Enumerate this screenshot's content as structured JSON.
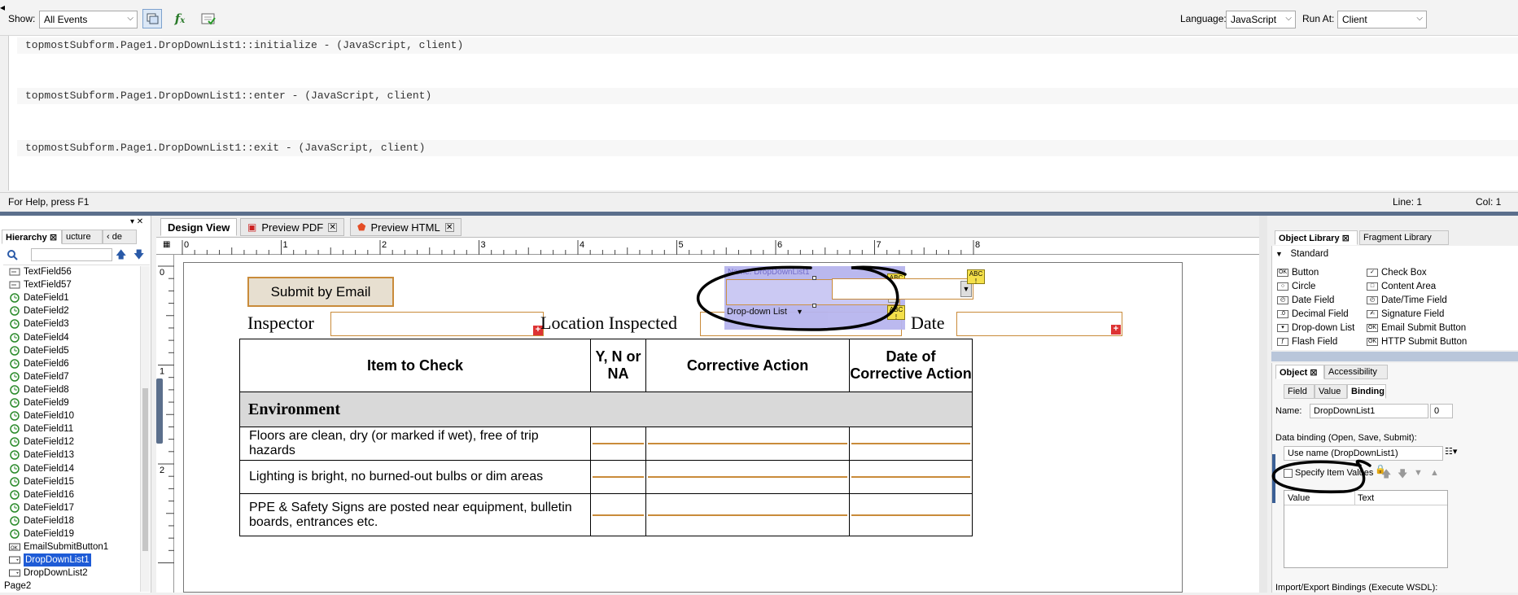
{
  "toolbar": {
    "show_label": "Show:",
    "show_value": "All Events",
    "language_label": "Language:",
    "language_value": "JavaScript",
    "run_at_label": "Run At:",
    "run_at_value": "Client"
  },
  "script": {
    "lines": [
      "topmostSubform.Page1.DropDownList1::initialize - (JavaScript, client)",
      "topmostSubform.Page1.DropDownList1::enter - (JavaScript, client)",
      "topmostSubform.Page1.DropDownList1::exit - (JavaScript, client)"
    ]
  },
  "status": {
    "help": "For Help, press F1",
    "line": "Line: 1",
    "col": "Col: 1"
  },
  "hierarchy": {
    "tabs": [
      "Hierarchy",
      "ucture",
      "de"
    ],
    "items": [
      {
        "label": "TextField56",
        "icon": "text-field"
      },
      {
        "label": "TextField57",
        "icon": "text-field"
      },
      {
        "label": "DateField1",
        "icon": "date-field"
      },
      {
        "label": "DateField2",
        "icon": "date-field"
      },
      {
        "label": "DateField3",
        "icon": "date-field"
      },
      {
        "label": "DateField4",
        "icon": "date-field"
      },
      {
        "label": "DateField5",
        "icon": "date-field"
      },
      {
        "label": "DateField6",
        "icon": "date-field"
      },
      {
        "label": "DateField7",
        "icon": "date-field"
      },
      {
        "label": "DateField8",
        "icon": "date-field"
      },
      {
        "label": "DateField9",
        "icon": "date-field"
      },
      {
        "label": "DateField10",
        "icon": "date-field"
      },
      {
        "label": "DateField11",
        "icon": "date-field"
      },
      {
        "label": "DateField12",
        "icon": "date-field"
      },
      {
        "label": "DateField13",
        "icon": "date-field"
      },
      {
        "label": "DateField14",
        "icon": "date-field"
      },
      {
        "label": "DateField15",
        "icon": "date-field"
      },
      {
        "label": "DateField16",
        "icon": "date-field"
      },
      {
        "label": "DateField17",
        "icon": "date-field"
      },
      {
        "label": "DateField18",
        "icon": "date-field"
      },
      {
        "label": "DateField19",
        "icon": "date-field"
      },
      {
        "label": "EmailSubmitButton1",
        "icon": "ok-button"
      },
      {
        "label": "DropDownList1",
        "icon": "dropdown",
        "selected": true
      },
      {
        "label": "DropDownList2",
        "icon": "dropdown"
      },
      {
        "label": "Page2",
        "icon": "page"
      }
    ]
  },
  "design": {
    "tabs": [
      "Design View",
      "Preview PDF",
      "Preview HTML"
    ],
    "ruler_h": [
      "0",
      "1",
      "2",
      "3",
      "4",
      "5",
      "6",
      "7",
      "8"
    ],
    "ruler_v": [
      "0",
      "1",
      "2"
    ],
    "submit_button": "Submit by Email",
    "inspector_label": "Inspector",
    "location_label": "Location Inspected",
    "date_label": "Date",
    "dropdown_name_tag": "Name: DropDownList1",
    "dropdown_caption": "Drop-down List",
    "abc_badge": "ABC",
    "table": {
      "headers": [
        "Item to Check",
        "Y, N or NA",
        "Corrective Action",
        "Date of Corrective Action"
      ],
      "section": "Environment",
      "rows": [
        "Floors are clean, dry (or marked if wet), free of trip hazards",
        "Lighting is bright, no burned-out bulbs or dim areas",
        "PPE & Safety Signs are posted near equipment, bulletin boards, entrances etc."
      ]
    }
  },
  "object_library": {
    "tabs": [
      "Object Library",
      "Fragment Library"
    ],
    "group": "Standard",
    "items_left": [
      "Button",
      "Circle",
      "Date Field",
      "Decimal Field",
      "Drop-down List",
      "Flash Field"
    ],
    "items_right": [
      "Check Box",
      "Content Area",
      "Date/Time Field",
      "Signature Field",
      "Email Submit Button",
      "HTTP Submit Button"
    ]
  },
  "object_panel": {
    "tabs": [
      "Object",
      "Accessibility"
    ],
    "subtabs": [
      "Field",
      "Value",
      "Binding"
    ],
    "name_label": "Name:",
    "name_value": "DropDownList1",
    "name_index": "0",
    "data_binding_label": "Data binding (Open, Save, Submit):",
    "data_binding_value": "Use name (DropDownList1)",
    "specify_label": "Specify Item Values",
    "col_value": "Value",
    "col_text": "Text",
    "import_export": "Import/Export Bindings (Execute WSDL):"
  },
  "colors": {
    "selection_blue": "#1e5bd6",
    "field_border": "#c98b3a",
    "annotation": "#000000"
  }
}
